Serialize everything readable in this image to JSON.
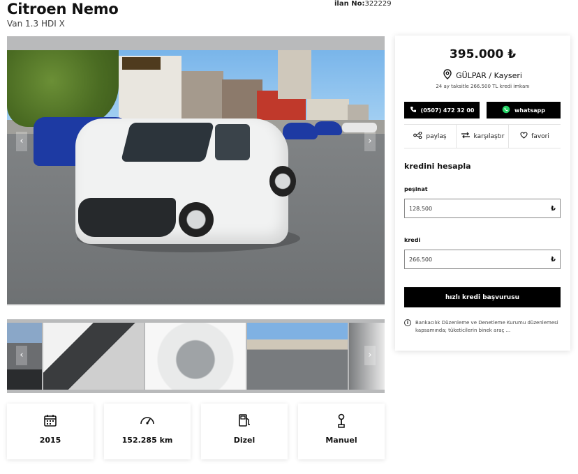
{
  "listing": {
    "title": "Citroen Nemo",
    "subtitle": "Van 1.3 HDI X",
    "ilan_label": "ilan No:",
    "ilan_no": "322229"
  },
  "gallery": {
    "prev_icon": "chevron-left-icon",
    "next_icon": "chevron-right-icon"
  },
  "specs": [
    {
      "icon": "calendar-icon",
      "value": "2015"
    },
    {
      "icon": "speedometer-icon",
      "value": "152.285 km"
    },
    {
      "icon": "fuel-pump-icon",
      "value": "Dizel"
    },
    {
      "icon": "gear-shift-icon",
      "value": "Manuel"
    }
  ],
  "panel": {
    "price": "395.000 ₺",
    "seller": "GÜLPAR / Kayseri",
    "credit_note": "24 ay taksitle 266.500 TL kredi imkanı",
    "phone": "(0507) 472 32 00",
    "whatsapp": "whatsapp",
    "actions": [
      {
        "icon": "share-icon",
        "label": "paylaş"
      },
      {
        "icon": "compare-icon",
        "label": "karşılaştır"
      },
      {
        "icon": "heart-icon",
        "label": "favori"
      }
    ],
    "calc_title": "kredini hesapla",
    "down_payment_label": "peşinat",
    "down_payment_value": "128.500",
    "loan_label": "kredi",
    "loan_value": "266.500",
    "currency": "₺",
    "apply_label": "hızlı kredi başvurusu",
    "info": "Bankacılık Düzenleme ve Denetleme Kurumu düzenlemesi kapsamında; tüketicilerin binek araç ..."
  },
  "colors": {
    "accent": "#000000",
    "whatsapp_green": "#25d366"
  }
}
